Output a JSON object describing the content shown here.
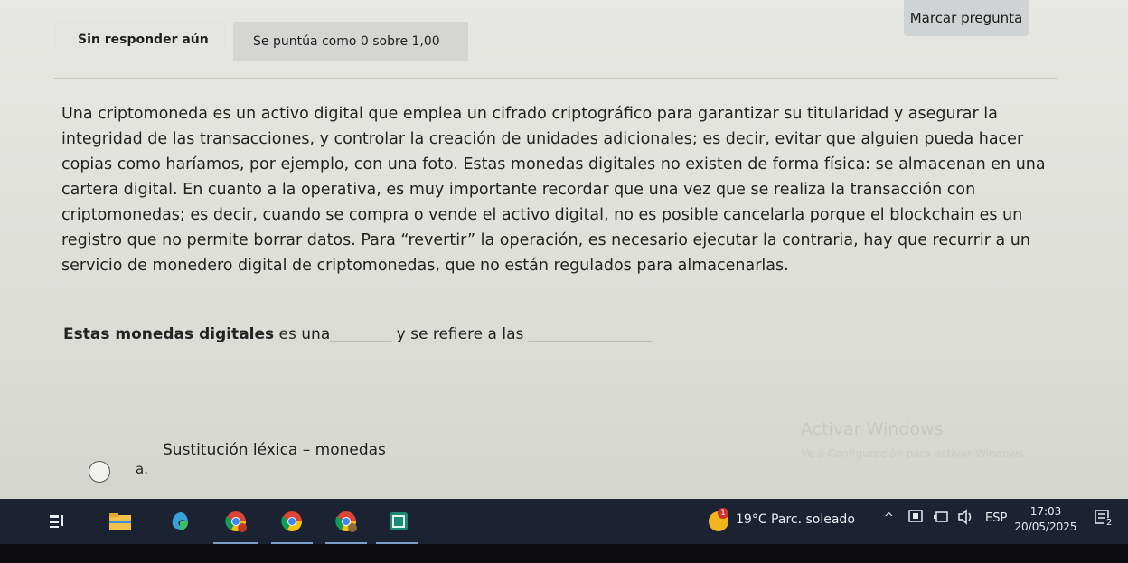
{
  "header": {
    "flag_label": "Marcar pregunta",
    "state_label": "Sin responder aún",
    "grade_label": "Se puntúa como 0 sobre 1,00"
  },
  "question": {
    "paragraph": "Una criptomoneda es un activo digital que emplea un cifrado criptográfico para garantizar su titularidad y asegurar la integridad de las transacciones, y controlar la creación de unidades adicionales; es decir, evitar que alguien pueda hacer copias como haríamos, por ejemplo, con una foto. Estas monedas digitales no existen de forma física: se almacenan en una cartera digital. En cuanto a la operativa, es muy importante recordar que una vez que se realiza la transacción con criptomonedas; es decir, cuando se compra o vende el activo digital, no es posible cancelarla porque el blockchain es un registro que no permite borrar datos. Para “revertir” la operación, es necesario ejecutar la contraria, hay que recurrir a un servicio de monedero digital de criptomonedas, que no están regulados para almacenarlas.",
    "prompt_bold": "Estas monedas digitales",
    "prompt_part1": " es una",
    "blank1": "________",
    "prompt_part2": " y se refiere a las ",
    "blank2": "________________"
  },
  "options": [
    {
      "letter": "a.",
      "text": "Sustitución léxica – monedas"
    }
  ],
  "watermark": {
    "line1": "Activar Windows",
    "line2": "Ve a Configuración para activar Windows."
  },
  "taskbar": {
    "weather": {
      "temp": "19°C",
      "condition": "Parc. soleado",
      "badge": "1"
    },
    "language": "ESP",
    "time": "17:03",
    "date": "20/05/2025",
    "notification_count": "2"
  }
}
